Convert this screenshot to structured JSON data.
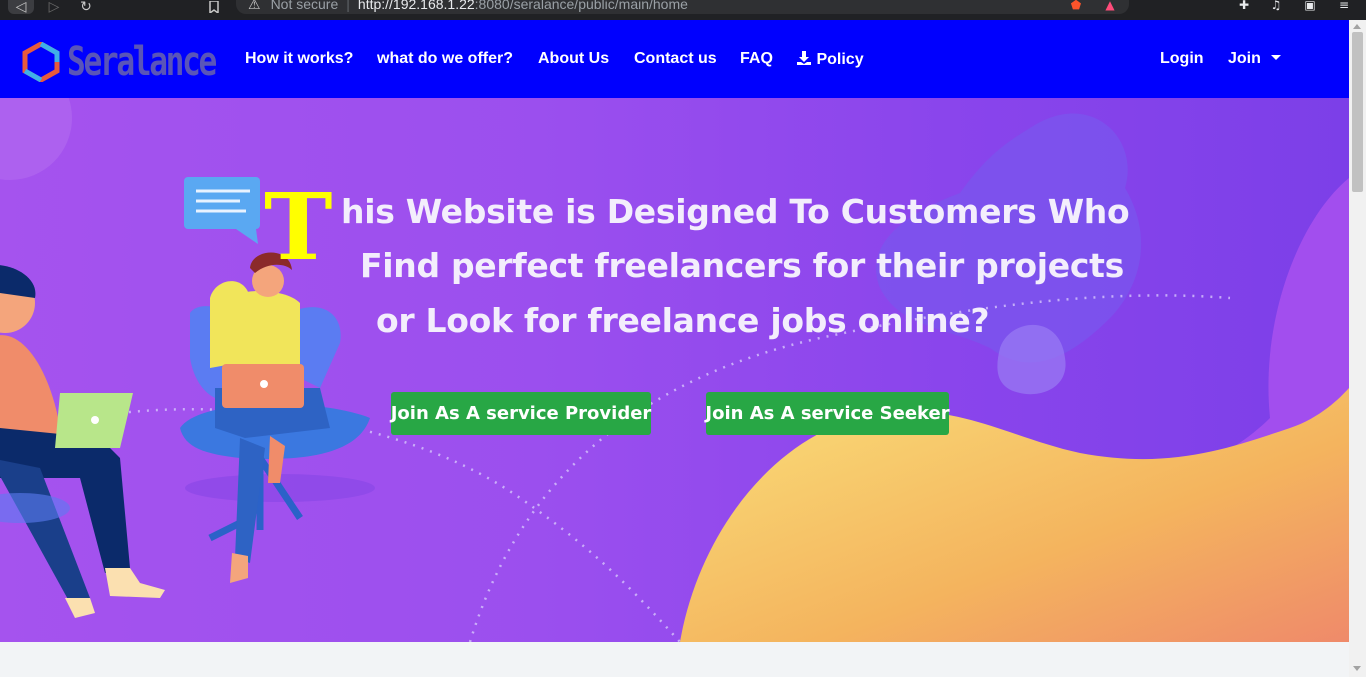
{
  "browser": {
    "security_label": "Not secure",
    "url_host": "http://192.168.1.22",
    "url_path": ":8080/seralance/public/main/home"
  },
  "navbar": {
    "brand": "Seralance",
    "links": [
      "How it works?",
      "what do we offer?",
      "About Us",
      "Contact us",
      "FAQ",
      "Policy"
    ],
    "login": "Login",
    "join": "Join",
    "bg_color": "#0000fe"
  },
  "hero": {
    "initial": "T",
    "line1": "his Website is Designed To Customers Who",
    "line2": "Find perfect freelancers for their projects",
    "line3": "or Look for freelance jobs online?",
    "btn_provider": "Join As A service Provider",
    "btn_seeker": "Join As A service Seeker",
    "button_color": "#28a745",
    "initial_color": "#ffff00"
  },
  "icons": [
    "back-icon",
    "forward-icon",
    "reload-icon",
    "bookmark-icon",
    "warning-icon",
    "brave-shield-icon",
    "brave-rewards-icon",
    "extensions-icon",
    "media-icon",
    "wallet-icon",
    "menu-icon",
    "download-icon",
    "caret-down-icon",
    "logo-icon"
  ]
}
